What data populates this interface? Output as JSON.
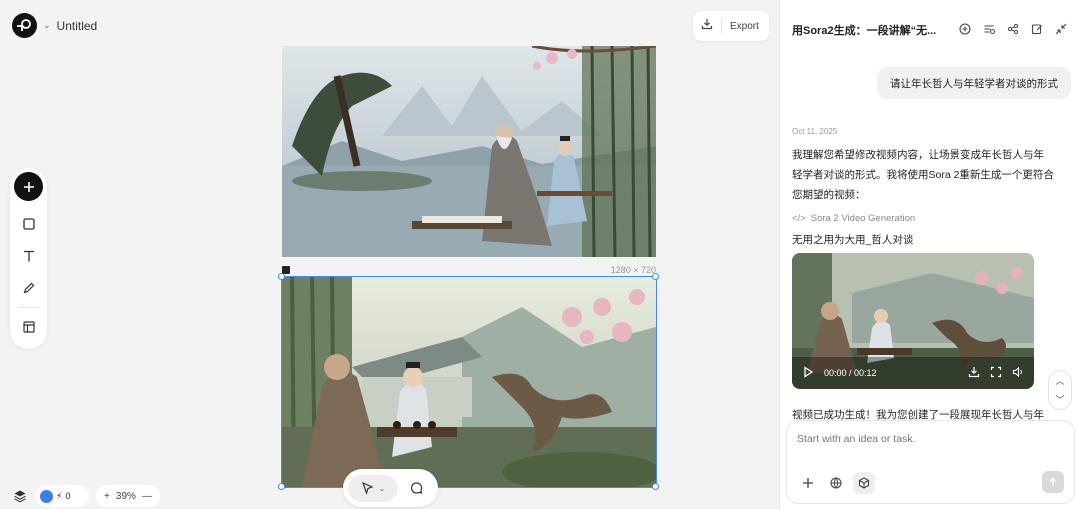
{
  "app": {
    "title": "Untitled"
  },
  "toolbar": {
    "export_label": "Export"
  },
  "canvas": {
    "image_size_label": "1280 × 720"
  },
  "status": {
    "credits": "0",
    "zoom": "39%"
  },
  "panel": {
    "title": "用Sora2生成：一段讲解“无...",
    "user_message": "请让年长哲人与年轻学者对谈的形式",
    "date": "Oct 11, 2025",
    "assistant_reply": "我理解您希望修改视频内容，让场景变成年长哲人与年轻学者对谈的形式。我将使用Sora 2重新生成一个更符合您期望的视频：",
    "generation_tag": "Sora 2 Video Generation",
    "video_title": "无用之用为大用_哲人对谈",
    "video_time": "00:00 / 00:12",
    "assistant_reply_2": "视频已成功生成！我为您创建了一段展现年长哲人与年",
    "input_placeholder": "Start with an idea or task."
  },
  "colors": {
    "accent": "#3d8bfd",
    "dark": "#111111"
  }
}
